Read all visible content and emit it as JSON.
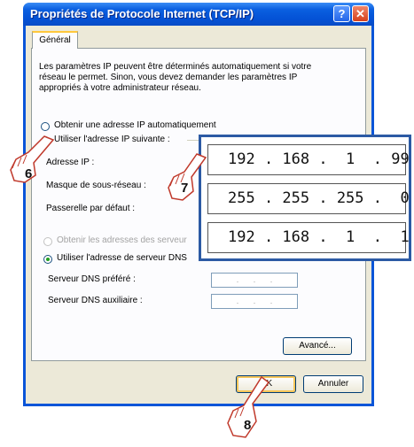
{
  "window": {
    "title": "Propriétés de Protocole Internet (TCP/IP)",
    "help_glyph": "?",
    "close_glyph": "✕"
  },
  "tabs": [
    {
      "label": "Général"
    }
  ],
  "description": "Les paramètres IP peuvent être déterminés automatiquement si votre réseau le permet. Sinon, vous devez demander les paramètres IP appropriés à votre administrateur réseau.",
  "ip_section": {
    "auto_option": "Obtenir une adresse IP automatiquement",
    "manual_option": "Utiliser l'adresse IP suivante :",
    "ip_label": "Adresse IP :",
    "mask_label": "Masque de sous-réseau :",
    "gateway_label": "Passerelle par défaut :"
  },
  "dns_section": {
    "auto_option": "Obtenir les adresses des serveur",
    "manual_option": "Utiliser l'adresse de serveur DNS",
    "preferred_label": "Serveur DNS préféré :",
    "alternate_label": "Serveur DNS auxiliaire :",
    "empty_ip": ". . ."
  },
  "buttons": {
    "advanced": "Avancé...",
    "ok": "OK",
    "cancel": "Annuler"
  },
  "zoom_panel": {
    "ip_address": "192 . 168 .  1  . 99",
    "subnet_mask": "255 . 255 . 255 .  0",
    "gateway": "192 . 168 .  1  .  1"
  },
  "callouts": {
    "step_6": "6",
    "step_7": "7",
    "step_8": "8"
  },
  "colors": {
    "title_bar": "#0a5fe0",
    "dialog_bg": "#ece9d8",
    "zoom_border": "#2c5aa4",
    "radio_selected": "#21a121"
  }
}
